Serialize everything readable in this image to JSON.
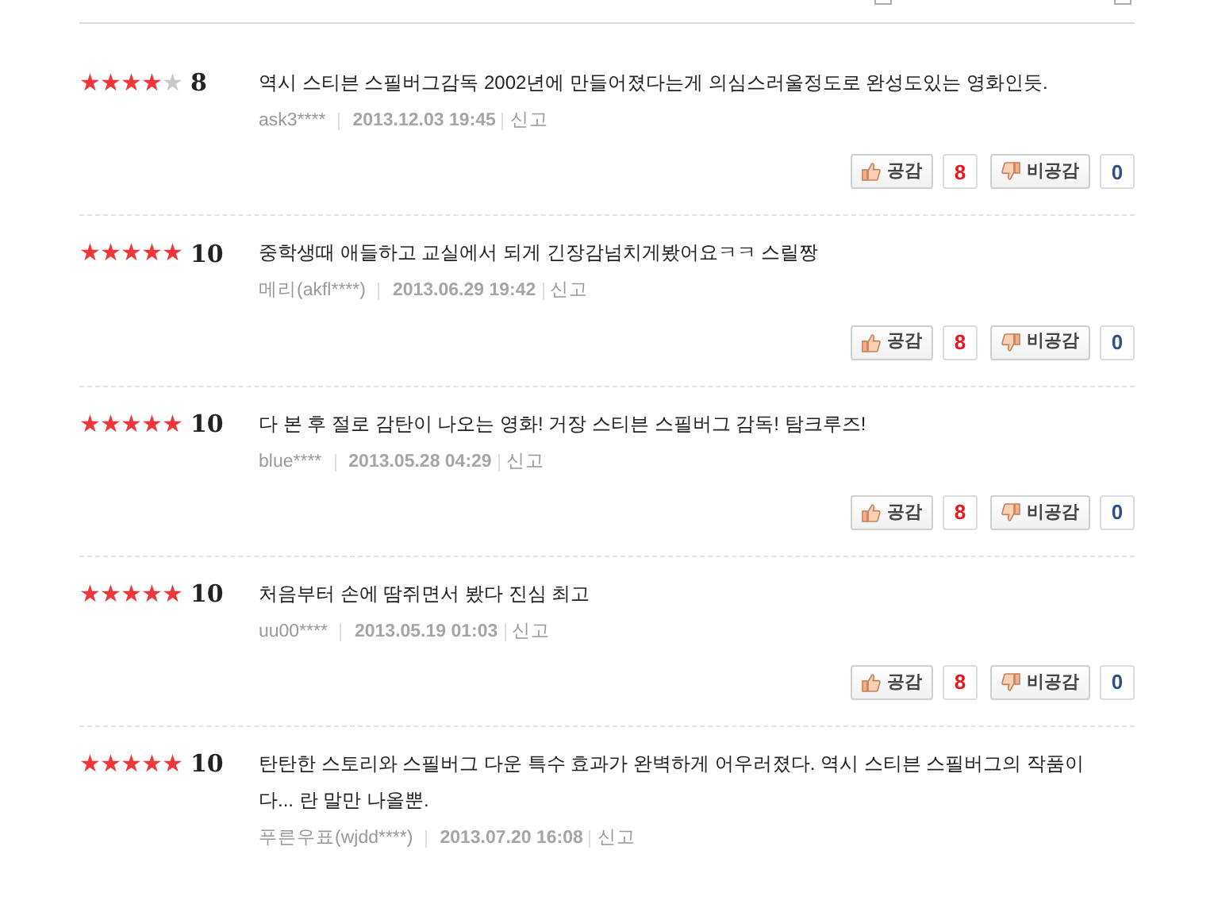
{
  "reviews": [
    {
      "stars": 4,
      "score": "8",
      "text": "역시 스티븐 스필버그감독 2002년에 만들어졌다는게 의심스러울정도로 완성도있는 영화인듯.",
      "author": "ask3****",
      "date": "2013.12.03 19:45",
      "report": "신고",
      "like_label": "공감",
      "likes": "8",
      "dislike_label": "비공감",
      "dislikes": "0"
    },
    {
      "stars": 5,
      "score": "10",
      "text": "중학생때 애들하고 교실에서 되게 긴장감넘치게봤어요ㅋㅋ 스릴짱",
      "author": "메리(akfl****)",
      "date": "2013.06.29 19:42",
      "report": "신고",
      "like_label": "공감",
      "likes": "8",
      "dislike_label": "비공감",
      "dislikes": "0"
    },
    {
      "stars": 5,
      "score": "10",
      "text": "다 본 후 절로 감탄이 나오는 영화! 거장 스티븐 스필버그 감독! 탐크루즈!",
      "author": "blue****",
      "date": "2013.05.28 04:29",
      "report": "신고",
      "like_label": "공감",
      "likes": "8",
      "dislike_label": "비공감",
      "dislikes": "0"
    },
    {
      "stars": 5,
      "score": "10",
      "text": "처음부터 손에 땀쥐면서 봤다 진심 최고",
      "author": "uu00****",
      "date": "2013.05.19 01:03",
      "report": "신고",
      "like_label": "공감",
      "likes": "8",
      "dislike_label": "비공감",
      "dislikes": "0"
    },
    {
      "stars": 5,
      "score": "10",
      "text": "탄탄한 스토리와 스필버그 다운 특수 효과가 완벽하게 어우러졌다. 역시 스티븐 스필버그의 작품이다... 란 말만 나올뿐.",
      "author": "푸른우표(wjdd****)",
      "date": "2013.07.20 16:08",
      "report": "신고"
    }
  ]
}
